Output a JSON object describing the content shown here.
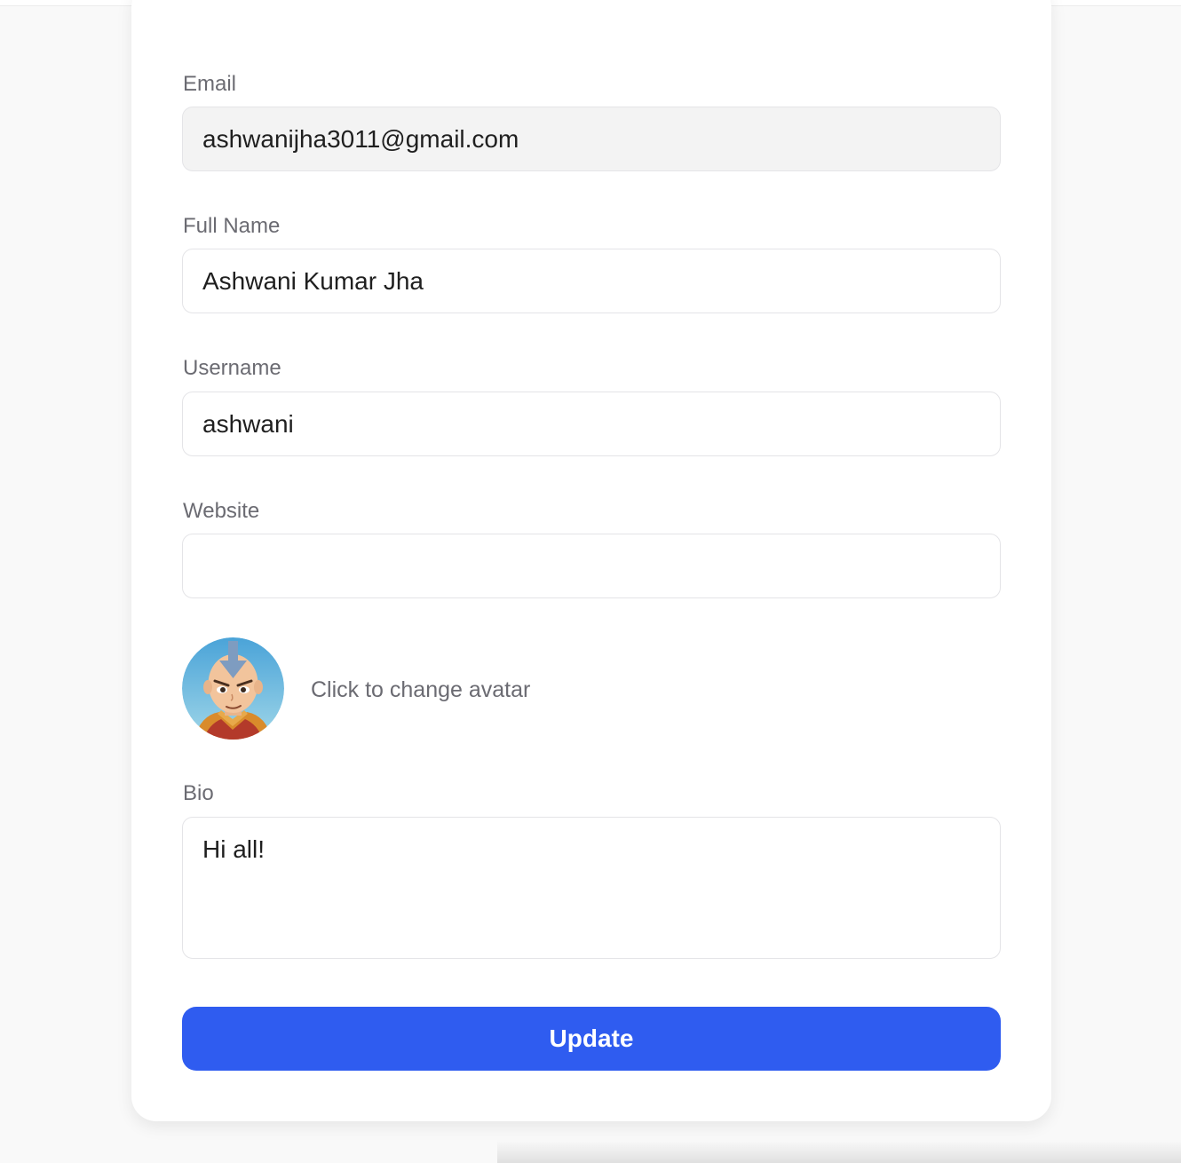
{
  "form": {
    "email": {
      "label": "Email",
      "value": "ashwanijha3011@gmail.com"
    },
    "full_name": {
      "label": "Full Name",
      "value": "Ashwani Kumar Jha"
    },
    "username": {
      "label": "Username",
      "value": "ashwani"
    },
    "website": {
      "label": "Website",
      "value": ""
    },
    "avatar": {
      "hint": "Click to change avatar",
      "icon": "avatar-image"
    },
    "bio": {
      "label": "Bio",
      "value": "Hi all!"
    },
    "submit_label": "Update"
  },
  "colors": {
    "primary": "#2f5cf0",
    "label": "#6b6b72",
    "readonly_bg": "#f3f3f3"
  }
}
